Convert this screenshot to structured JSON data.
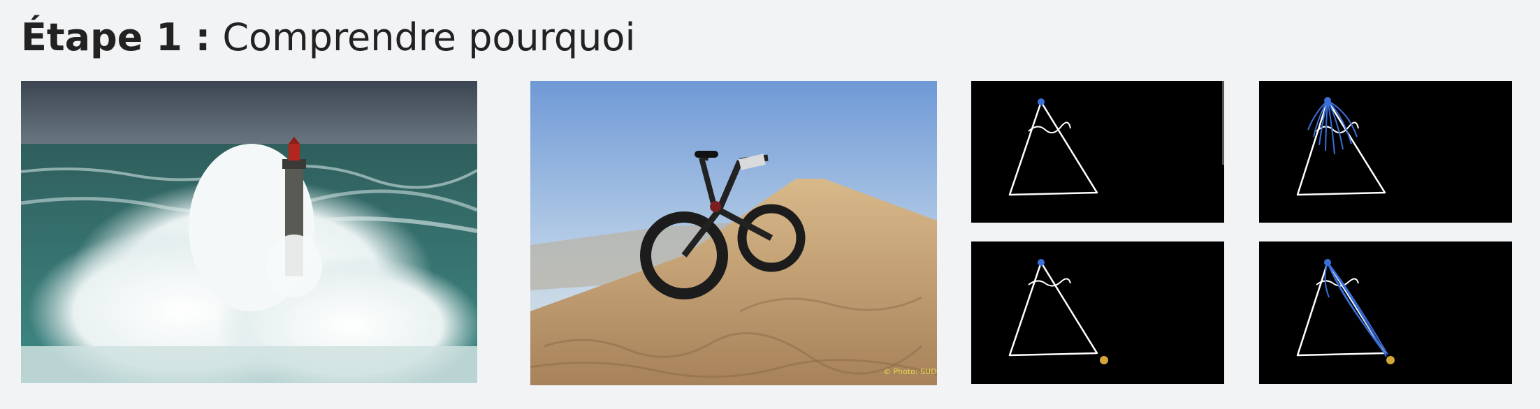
{
  "slide": {
    "title_bold": "Étape 1 :",
    "title_rest": " Comprendre pourquoi"
  },
  "photos": {
    "bike_watermark": "© Photo: SUD"
  },
  "colors": {
    "background": "#f2f3f5",
    "sketch_background": "#000000",
    "sketch_line": "#ffffff",
    "start_point": "#3a6fd8",
    "end_point": "#d4a73c",
    "path_lines": "#3a6fd8"
  }
}
